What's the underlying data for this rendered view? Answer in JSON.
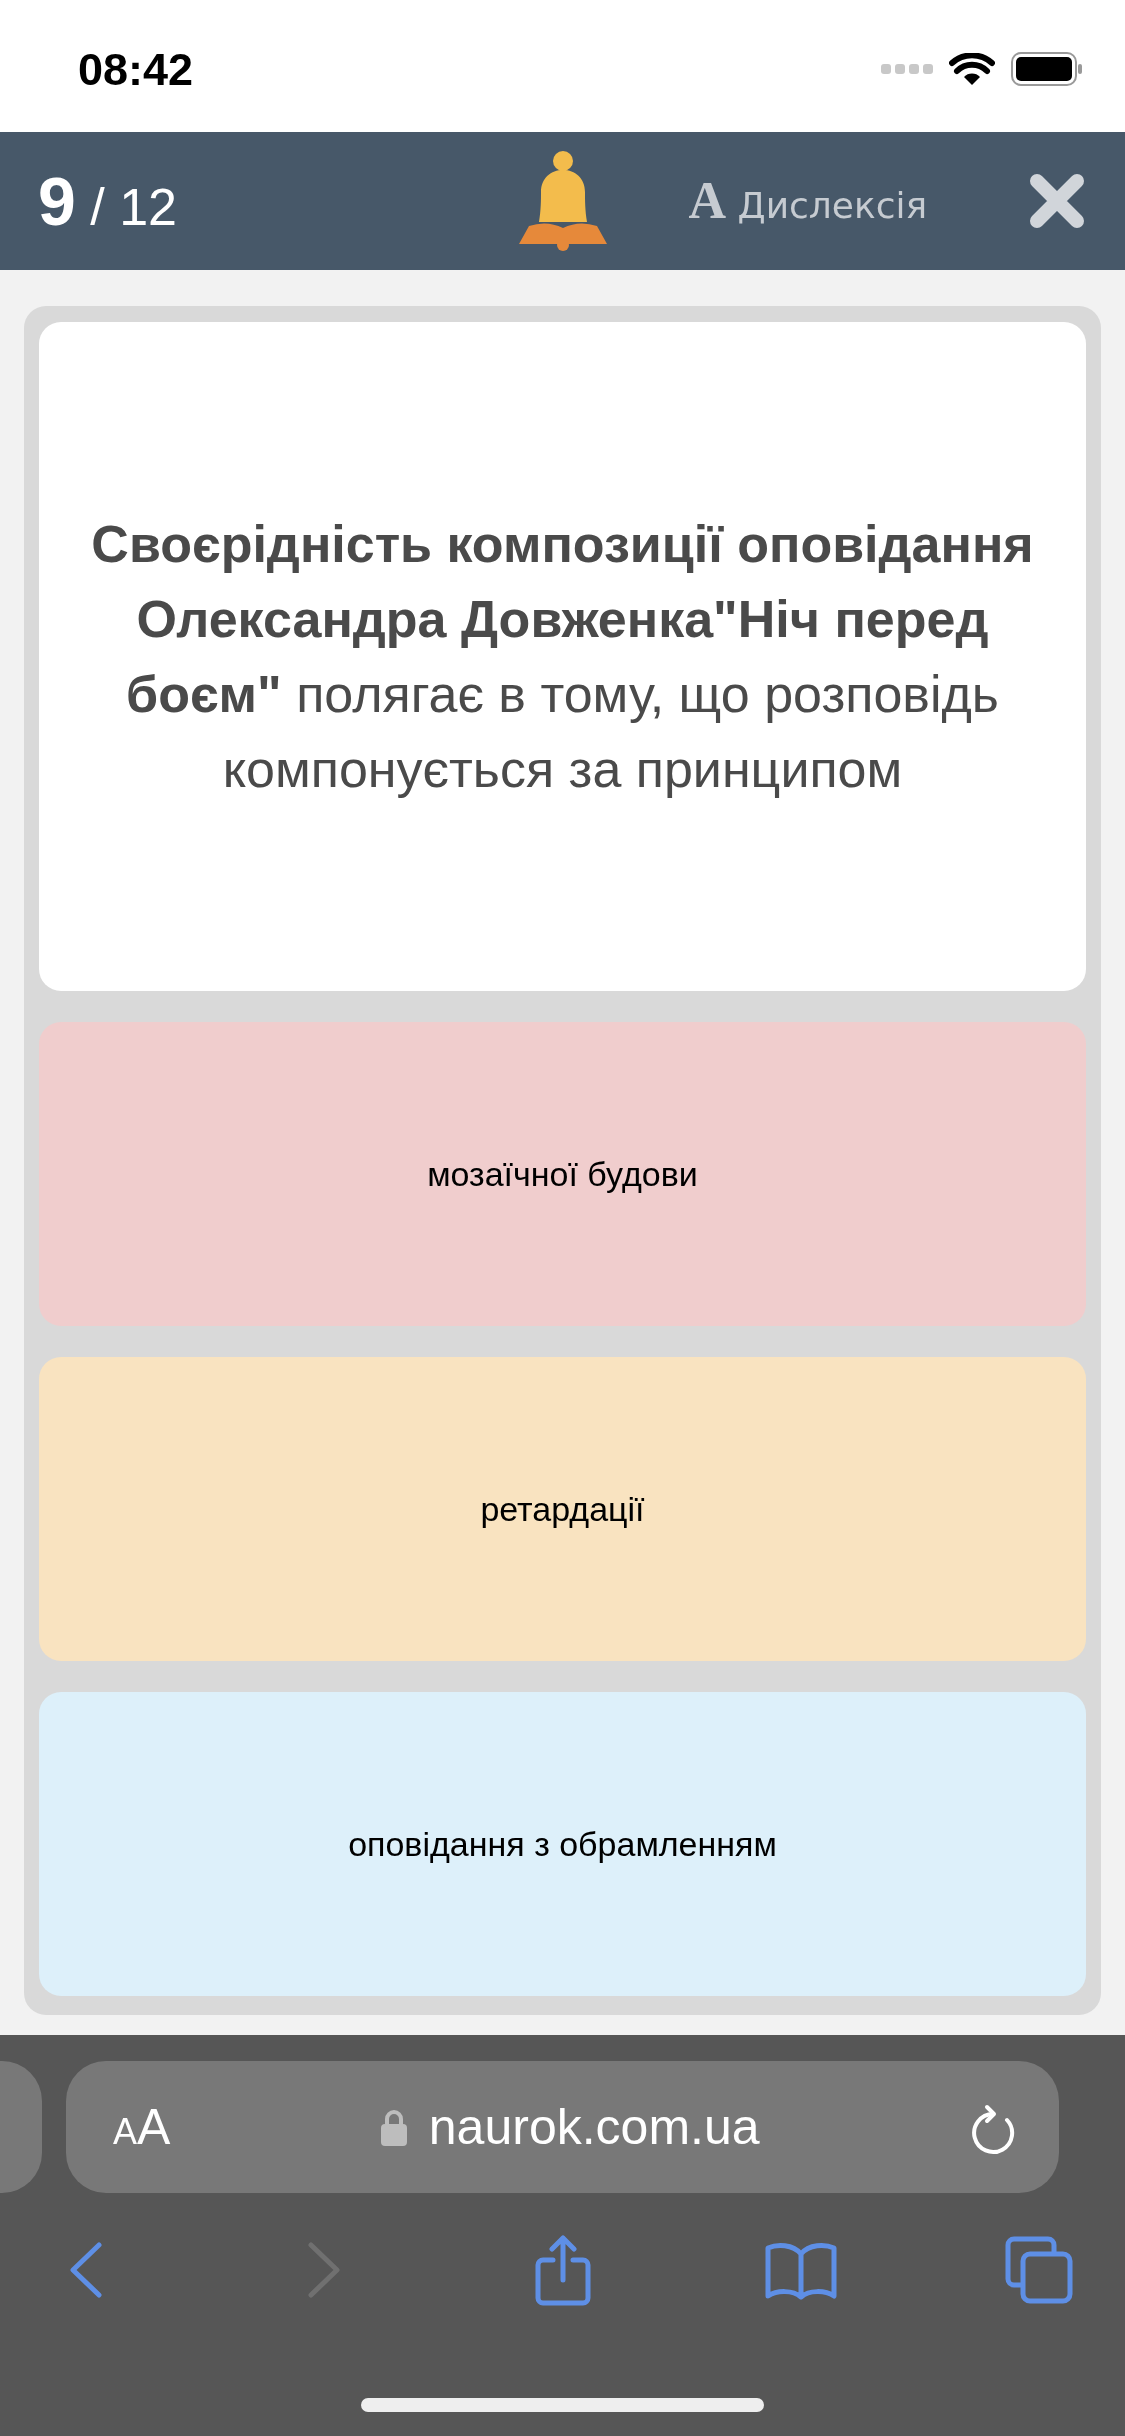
{
  "status_bar": {
    "time": "08:42"
  },
  "header": {
    "progress": "**9** / 12",
    "dyslexia_button": "**А** Дислексія"
  },
  "question": {
    "text": "**Своєрідність композиції оповідання Олександра Довженка\"Ніч перед боєм\"** полягає в тому, що розповідь компонується за принципом"
  },
  "answers": [
    {
      "text": "мозаїчної будови",
      "color": "#f0cdcd"
    },
    {
      "text": "ретардації",
      "color": "#f9e3c0"
    },
    {
      "text": "оповідання з обрамленням",
      "color": "#ddf0fa"
    }
  ],
  "browser": {
    "text_size_button": "AA",
    "url": "naurok.com.ua",
    "toolbar": [
      {
        "kind": "back",
        "disabled": false
      },
      {
        "kind": "forward",
        "disabled": true
      },
      {
        "kind": "share",
        "disabled": false
      },
      {
        "kind": "bookmarks",
        "disabled": false
      },
      {
        "kind": "tabs",
        "disabled": false
      }
    ]
  }
}
